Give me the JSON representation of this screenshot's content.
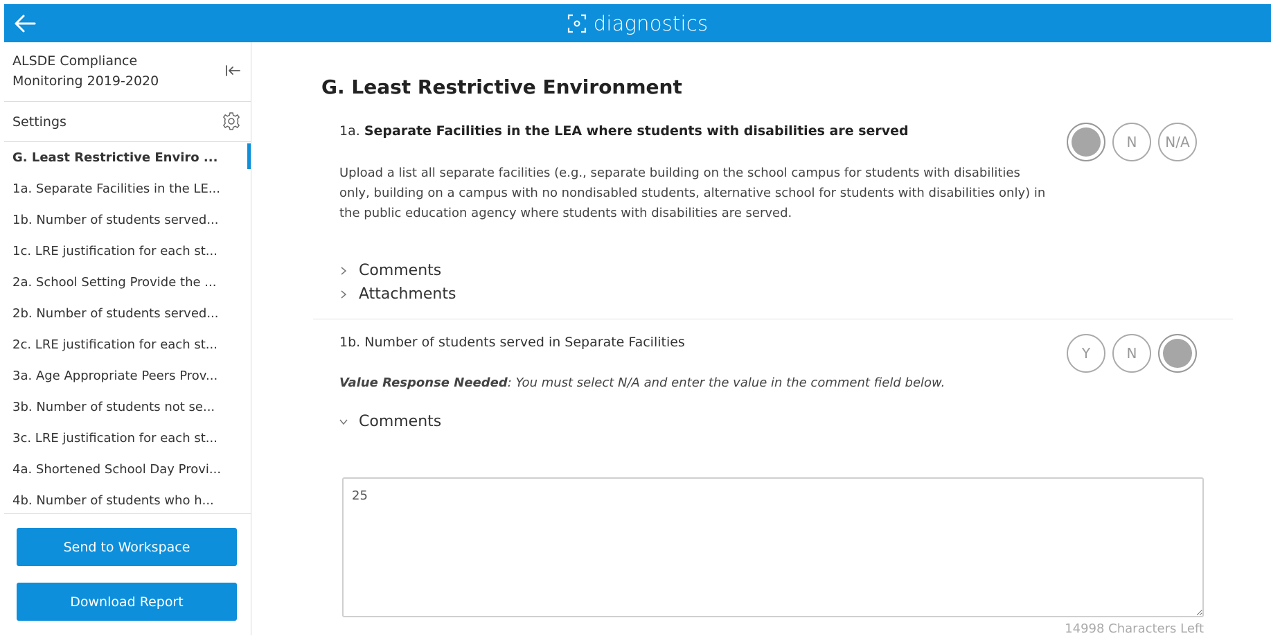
{
  "topbar": {
    "brand": "diagnostics"
  },
  "sidebar": {
    "title": "ALSDE Compliance Monitoring 2019-2020",
    "settings_label": "Settings",
    "items": [
      {
        "label": "G. Least Restrictive Enviro ..."
      },
      {
        "label": "1a. Separate Facilities in the LE..."
      },
      {
        "label": "1b. Number of students served..."
      },
      {
        "label": "1c. LRE justification for each st..."
      },
      {
        "label": "2a. School Setting Provide the ..."
      },
      {
        "label": "2b. Number of students served..."
      },
      {
        "label": "2c. LRE justification for each st..."
      },
      {
        "label": "3a. Age Appropriate Peers Prov..."
      },
      {
        "label": "3b. Number of students not se..."
      },
      {
        "label": "3c. LRE justification for each st..."
      },
      {
        "label": "4a. Shortened School Day Provi..."
      },
      {
        "label": "4b. Number of students who h..."
      }
    ],
    "send_button": "Send to Workspace",
    "download_button": "Download Report"
  },
  "main": {
    "section_title": "G. Least Restrictive Environment",
    "q1": {
      "number": "1a.",
      "title": "Separate Facilities in the LEA where students with disabilities are served",
      "description": "Upload a list all separate facilities (e.g., separate building on the school campus for students with disabilities only, building on a campus with no nondisabled students, alternative school for students with disabilities only) in the public education agency where students with disabilities are served.",
      "choices": {
        "y": "",
        "n": "N",
        "na": "N/A"
      },
      "selected": "Y",
      "comments_label": "Comments",
      "attachments_label": "Attachments"
    },
    "q2": {
      "title": "1b. Number of students served in Separate Facilities",
      "note_bold": "Value Response Needed",
      "note_rest": ": You must select N/A and enter the value in the comment field below.",
      "choices": {
        "y": "Y",
        "n": "N",
        "na": ""
      },
      "selected": "N/A",
      "comments_label": "Comments",
      "comment_value": "25",
      "chars_left": "14998 Characters Left"
    }
  }
}
